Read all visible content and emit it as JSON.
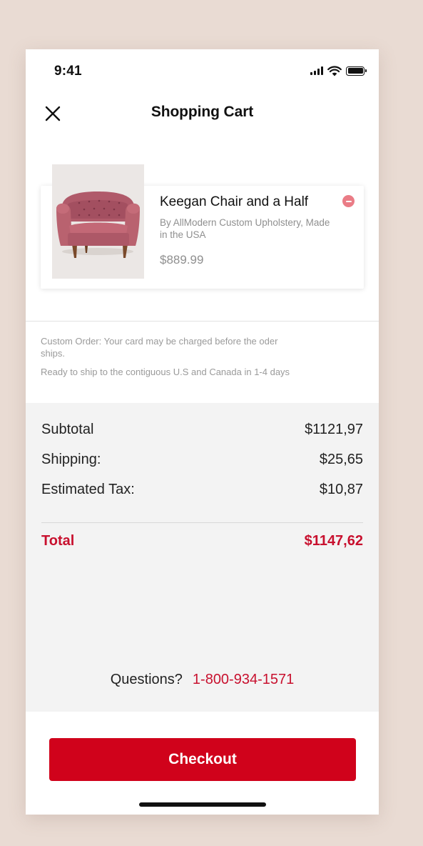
{
  "status_bar": {
    "time": "9:41"
  },
  "nav": {
    "title": "Shopping Cart",
    "close_icon": "close-icon"
  },
  "item": {
    "name": "Keegan Chair and a Half",
    "description": "By AllModern Custom Upholstery, Made in the USA",
    "price": "$889.99",
    "image": "pink-tufted-armchair",
    "remove_icon": "remove-icon"
  },
  "notes": {
    "custom_order": "Custom Order: Your card may be charged before the oder ships.",
    "shipping": "Ready to ship to the contiguous U.S and Canada in 1-4 days"
  },
  "summary": {
    "subtotal_label": "Subtotal",
    "subtotal_value": "$1121,97",
    "shipping_label": "Shipping:",
    "shipping_value": "$25,65",
    "tax_label": "Estimated Tax:",
    "tax_value": "$10,87",
    "total_label": "Total",
    "total_value": "$1147,62"
  },
  "help": {
    "question": "Questions?",
    "phone": "1-800-934-1571"
  },
  "checkout": {
    "label": "Checkout"
  },
  "colors": {
    "accent": "#d0021b",
    "background": "#e9dbd3",
    "summary_bg": "#f3f3f3",
    "muted_text": "#8f8f8f",
    "remove_badge": "#ea7c86"
  }
}
